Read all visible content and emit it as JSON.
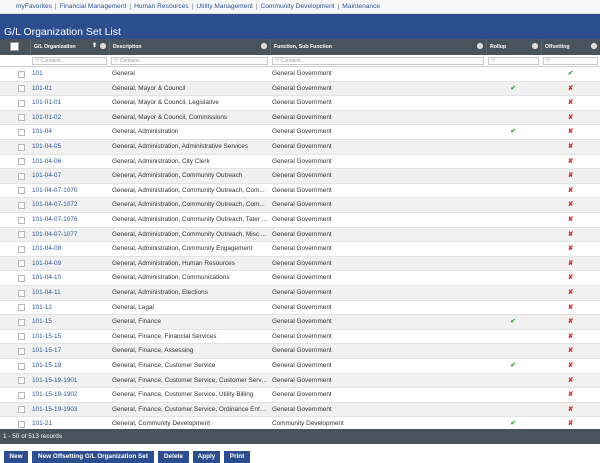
{
  "topnav": {
    "links": [
      "myFavorites",
      "Financial Management",
      "Human Resources",
      "Utility Management",
      "Community Development",
      "Maintenance"
    ]
  },
  "page_title": "G/L Organization Set List",
  "columns": {
    "organization": "G/L Organization",
    "description": "Description",
    "function": "Function, Sub Function",
    "rollup": "Rollup",
    "offsetting": "Offsetting"
  },
  "filters": {
    "organization_placeholder": "Contains...",
    "description_placeholder": "Contains...",
    "function_placeholder": "Contains...",
    "rollup_placeholder": "",
    "offsetting_placeholder": ""
  },
  "marks": {
    "check": "✔",
    "cross": "✘"
  },
  "colors": {
    "header_bg": "#2c4e8f",
    "grid_header_bg": "#49535b",
    "link": "#2d5597",
    "check": "#2e9e38",
    "cross": "#d72b2b"
  },
  "rows": [
    {
      "org": "101",
      "desc": "General",
      "func": "General Government",
      "rollup": "",
      "offsetting": "✔"
    },
    {
      "org": "101-01",
      "desc": "General, Mayor & Council",
      "func": "General Government",
      "rollup": "✔",
      "offsetting": "✘"
    },
    {
      "org": "101-01-01",
      "desc": "General, Mayor & Council, Legislative",
      "func": "General Government",
      "rollup": "",
      "offsetting": "✘"
    },
    {
      "org": "101-01-02",
      "desc": "General, Mayor & Council, Commissions",
      "func": "General Government",
      "rollup": "",
      "offsetting": "✘"
    },
    {
      "org": "101-04",
      "desc": "General, Administration",
      "func": "General Government",
      "rollup": "✔",
      "offsetting": "✘"
    },
    {
      "org": "101-04-05",
      "desc": "General, Administration, Administrative Services",
      "func": "General Government",
      "rollup": "",
      "offsetting": "✘"
    },
    {
      "org": "101-04-06",
      "desc": "General, Administration, City Clerk",
      "func": "General Government",
      "rollup": "",
      "offsetting": "✘"
    },
    {
      "org": "101-04-07",
      "desc": "General, Administration, Community Outreach",
      "func": "General Government",
      "rollup": "",
      "offsetting": "✘"
    },
    {
      "org": "101-04-07-1070",
      "desc": "General, Administration, Community Outreach, Com...",
      "func": "General Government",
      "rollup": "",
      "offsetting": "✘"
    },
    {
      "org": "101-04-07-1072",
      "desc": "General, Administration, Community Outreach, Com...",
      "func": "General Government",
      "rollup": "",
      "offsetting": "✘"
    },
    {
      "org": "101-04-07-1076",
      "desc": "General, Administration, Community Outreach, Tater ...",
      "func": "General Government",
      "rollup": "",
      "offsetting": "✘"
    },
    {
      "org": "101-04-07-1077",
      "desc": "General, Administration, Community Outreach, Misc ...",
      "func": "General Government",
      "rollup": "",
      "offsetting": "✘"
    },
    {
      "org": "101-04-08",
      "desc": "General, Administration, Community Engagement",
      "func": "General Government",
      "rollup": "",
      "offsetting": "✘"
    },
    {
      "org": "101-04-09",
      "desc": "General, Administration, Human Resources",
      "func": "General Government",
      "rollup": "",
      "offsetting": "✘"
    },
    {
      "org": "101-04-10",
      "desc": "General, Administration, Communications",
      "func": "General Government",
      "rollup": "",
      "offsetting": "✘"
    },
    {
      "org": "101-04-11",
      "desc": "General, Administration, Elections",
      "func": "General Government",
      "rollup": "",
      "offsetting": "✘"
    },
    {
      "org": "101-12",
      "desc": "General, Legal",
      "func": "General Government",
      "rollup": "",
      "offsetting": "✘"
    },
    {
      "org": "101-15",
      "desc": "General, Finance",
      "func": "General Government",
      "rollup": "✔",
      "offsetting": "✘"
    },
    {
      "org": "101-15-15",
      "desc": "General, Finance, Financial Services",
      "func": "General Government",
      "rollup": "",
      "offsetting": "✘"
    },
    {
      "org": "101-15-17",
      "desc": "General, Finance, Assessing",
      "func": "General Government",
      "rollup": "",
      "offsetting": "✘"
    },
    {
      "org": "101-15-19",
      "desc": "General, Finance, Customer Service",
      "func": "General Government",
      "rollup": "✔",
      "offsetting": "✘"
    },
    {
      "org": "101-15-19-1901",
      "desc": "General, Finance, Customer Service, Customer Servic...",
      "func": "General Government",
      "rollup": "",
      "offsetting": "✘"
    },
    {
      "org": "101-15-19-1902",
      "desc": "General, Finance, Customer Service, Utility Billing",
      "func": "General Government",
      "rollup": "",
      "offsetting": "✘"
    },
    {
      "org": "101-15-19-1903",
      "desc": "General, Finance, Customer Service, Ordinance Enforc...",
      "func": "General Government",
      "rollup": "",
      "offsetting": "✘"
    },
    {
      "org": "101-21",
      "desc": "General, Community Development",
      "func": "Community Development",
      "rollup": "✔",
      "offsetting": "✘"
    }
  ],
  "status": "1 - 50 of 513 records",
  "buttons": {
    "new": "New",
    "new_offsetting": "New Offsetting G/L Organization Set",
    "delete": "Delete",
    "apply": "Apply",
    "print": "Print"
  }
}
